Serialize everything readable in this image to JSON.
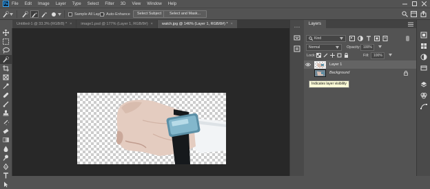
{
  "menubar": {
    "app_logo": "Ps",
    "items": [
      "File",
      "Edit",
      "Image",
      "Layer",
      "Type",
      "Select",
      "Filter",
      "3D",
      "View",
      "Window",
      "Help"
    ],
    "window_controls": [
      "minimize-icon",
      "maximize-icon",
      "close-icon"
    ]
  },
  "options_bar": {
    "sample_all_layers": "Sample All Layers",
    "auto_enhance": "Auto-Enhance",
    "select_subject": "Select Subject",
    "select_and_mask": "Select and Mask...",
    "sample_all_checked": false,
    "auto_enhance_checked": false
  },
  "tabs": [
    {
      "label": "Untitled-1 @ 33.3% (RGB/8) *",
      "active": false
    },
    {
      "label": "image1.psd @ 177% (Layer 1, RGB/8#)",
      "active": false
    },
    {
      "label": "watch.jpg @ 146% (Layer 1, RGB/8#) *",
      "active": true
    }
  ],
  "tab_close": "×",
  "layers_panel": {
    "title": "Layers",
    "kind_label": "Kind",
    "blend_mode": "Normal",
    "opacity_label": "Opacity:",
    "opacity_value": "100%",
    "lock_label": "Lock:",
    "fill_label": "Fill:",
    "fill_value": "100%",
    "layers": [
      {
        "name": "Layer 1",
        "visible": true,
        "selected": true
      },
      {
        "name": "Background",
        "visible": false,
        "selected": false,
        "locked": true
      }
    ],
    "tooltip": "Indicates layer visibility"
  },
  "colors": {
    "ui_gray": "#535353",
    "canvas_bg": "#282828",
    "ps_blue": "#31a8ff",
    "selected_layer": "#646464",
    "tooltip_bg": "#fbfbd7"
  }
}
